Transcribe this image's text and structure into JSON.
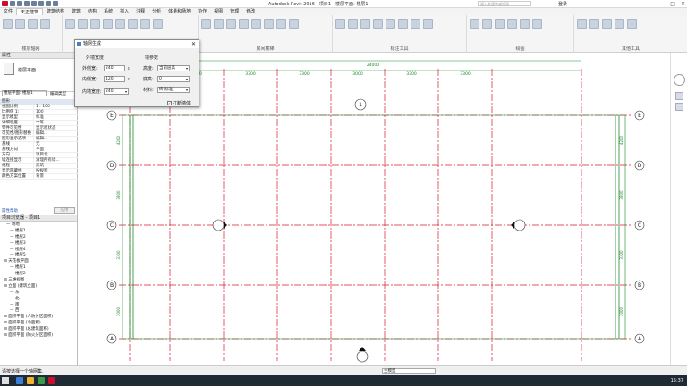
{
  "titlebar": {
    "title": "Autodesk Revit 2016 -    项目1 - 楼层平面: 楼层1",
    "search_placeholder": "键入关键字或短语",
    "login": "登录"
  },
  "menu": [
    "文件",
    "天正建筑",
    "建筑结构",
    "建筑",
    "结构",
    "系统",
    "插入",
    "注释",
    "分析",
    "体量和场地",
    "协作",
    "视图",
    "管理",
    "修改"
  ],
  "ribbon_groups": [
    {
      "label": "楼层轴网"
    },
    {
      "label": ""
    },
    {
      "label": "房间楼梯"
    },
    {
      "label": "标注工具"
    },
    {
      "label": "绘图"
    },
    {
      "label": "其他工具"
    }
  ],
  "dialog": {
    "title": "轴网生成",
    "section_left": "外墙宽度",
    "section_right": "墙参数",
    "fields_left": [
      {
        "label": "外侧宽:",
        "value": "240"
      },
      {
        "label": "内侧宽:",
        "value": "120"
      },
      {
        "label": "内墙宽度:",
        "value": "240"
      }
    ],
    "fields_right": [
      {
        "label": "高度:",
        "value": "当前层高"
      },
      {
        "label": "底高:",
        "value": "0"
      },
      {
        "label": "材料:",
        "value": "砖(标准)"
      }
    ],
    "checkbox": "打断墙体"
  },
  "properties": {
    "title": "属性",
    "type_name": "楼层平面",
    "type_select": "楼层平面: 楼层1",
    "edit_type": "编辑类型",
    "group": "图形",
    "rows": [
      {
        "k": "视图比例",
        "v": "1 : 100"
      },
      {
        "k": "比例值 1:",
        "v": "100"
      },
      {
        "k": "显示模型",
        "v": "标准"
      },
      {
        "k": "详细程度",
        "v": "中等"
      },
      {
        "k": "零件可见性",
        "v": "显示原状态"
      },
      {
        "k": "可见性/图形替换",
        "v": "编辑..."
      },
      {
        "k": "图形显示选项",
        "v": "编辑..."
      },
      {
        "k": "基线",
        "v": "无"
      },
      {
        "k": "基线方向",
        "v": "平面"
      },
      {
        "k": "方向",
        "v": "项目北"
      },
      {
        "k": "墙连接显示",
        "v": "清理所有墙..."
      },
      {
        "k": "规程",
        "v": "建筑"
      },
      {
        "k": "显示隐藏线",
        "v": "按规程"
      },
      {
        "k": "颜色方案位置",
        "v": "背景"
      }
    ],
    "help": "属性帮助",
    "apply": "应用"
  },
  "browser": {
    "title": "项目浏览器 - 项目1",
    "items": [
      "场地",
      "楼层1",
      "楼层2",
      "楼层3",
      "楼层4",
      "楼层5",
      "天花板平面",
      "楼层1",
      "楼层2",
      "三维视图",
      "立面 (建筑立面)",
      "东",
      "北",
      "南",
      "西",
      "面积平面 (人防分区面积)",
      "面积平面 (净面积)",
      "面积平面 (总建筑面积)",
      "面积平面 (防火分区面积)"
    ]
  },
  "canvas": {
    "top_dims_outer": [
      "24000"
    ],
    "top_dims": [
      "4800",
      "3000",
      "3300",
      "3300",
      "3000",
      "3300",
      "3300"
    ],
    "side_dims": [
      "4200",
      "3300",
      "3300",
      "3000"
    ],
    "row_axes": [
      "E",
      "D",
      "C",
      "B",
      "A"
    ],
    "col_marks": [
      "1"
    ]
  },
  "status": {
    "text": "请按选择一个轴网集.",
    "model": "主模型"
  },
  "taskbar": {
    "time": "15:37"
  },
  "colors": {
    "grid_red": "#d81b2a",
    "wall_green": "#1a8a2a",
    "accent": "#4a7fc1"
  }
}
